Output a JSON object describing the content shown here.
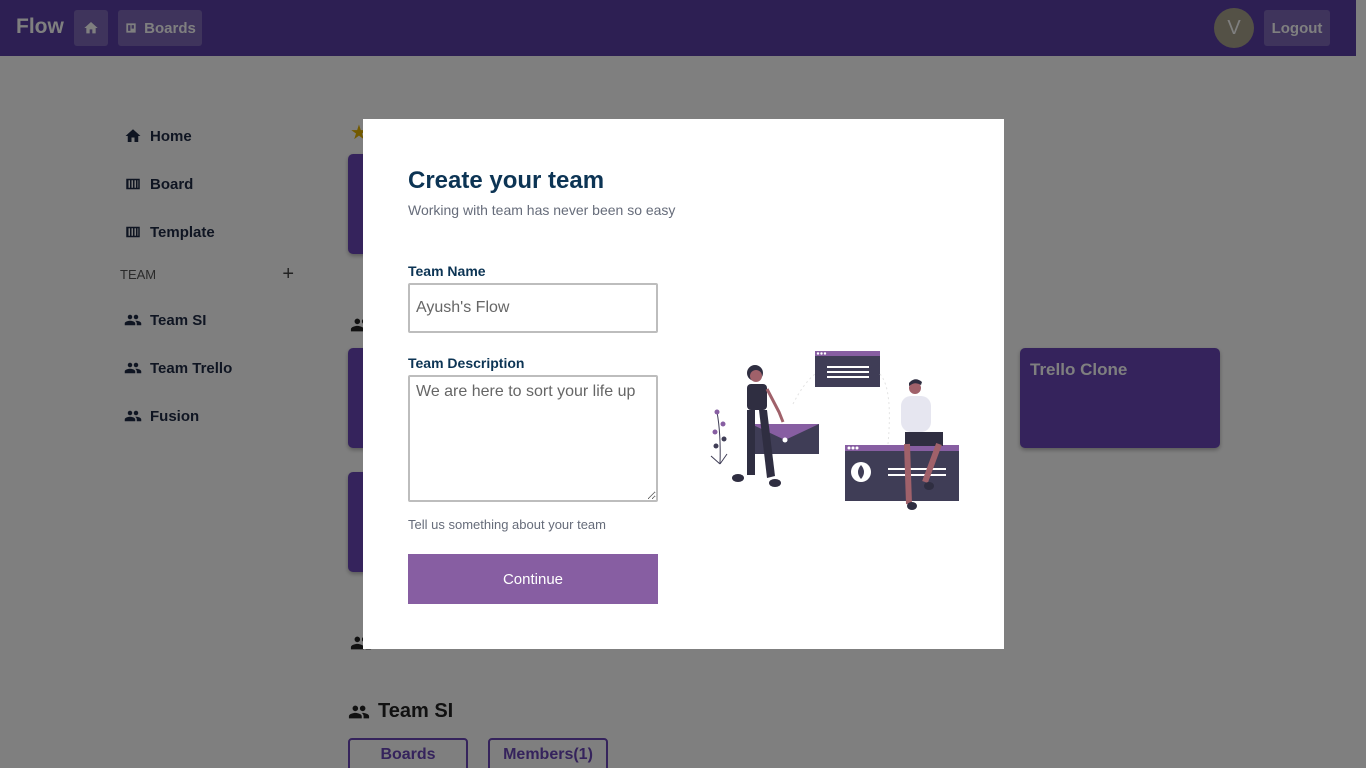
{
  "topbar": {
    "brand": "Flow",
    "boards_label": "Boards",
    "avatar_initial": "V",
    "logout_label": "Logout"
  },
  "sidebar": {
    "items": [
      {
        "label": "Home",
        "icon": "home-icon"
      },
      {
        "label": "Board",
        "icon": "board-icon"
      },
      {
        "label": "Template",
        "icon": "board-icon"
      }
    ],
    "team_header": "TEAM",
    "teams": [
      {
        "label": "Team SI",
        "icon": "people-icon"
      },
      {
        "label": "Team Trello",
        "icon": "people-icon"
      },
      {
        "label": "Fusion",
        "icon": "people-icon"
      }
    ]
  },
  "main": {
    "visible_card": "Trello Clone",
    "team_section_title": "Team SI",
    "tabs": [
      "Boards",
      "Members(1)"
    ]
  },
  "modal": {
    "title": "Create your team",
    "subtitle": "Working with team has never been so easy",
    "name_label": "Team Name",
    "name_placeholder": "Ayush's Flow",
    "desc_label": "Team Description",
    "desc_placeholder": "We are here to sort your life up",
    "hint": "Tell us something about your team",
    "continue_label": "Continue"
  },
  "colors": {
    "primary": "#5a3fa6",
    "card": "#6a46b9",
    "button": "#875ea2",
    "heading": "#0c3454"
  }
}
